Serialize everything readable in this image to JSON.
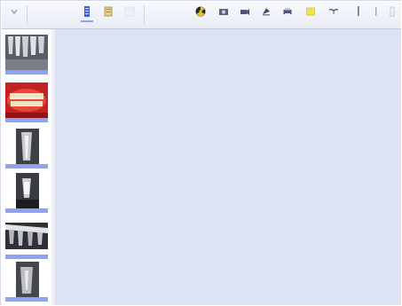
{
  "toolbar": {
    "left_buttons": [
      {
        "icon": "chevron-down-icon"
      },
      {
        "icon": "patient-list-icon"
      },
      {
        "icon": "folder-icon"
      },
      {
        "icon": "blank-icon"
      }
    ],
    "right_buttons": [
      {
        "icon": "radiation-icon"
      },
      {
        "icon": "camera-icon"
      },
      {
        "icon": "video-camera-icon"
      },
      {
        "icon": "scanner-icon"
      },
      {
        "icon": "print-icon"
      },
      {
        "icon": "note-icon"
      },
      {
        "icon": "tooth-chart-icon"
      },
      {
        "icon": "ruler-icon"
      },
      {
        "icon": "zoom-icon"
      },
      {
        "icon": "settings-icon"
      }
    ]
  },
  "sidebar": {
    "thumbnails": [
      {
        "type": "xray-bitewing"
      },
      {
        "type": "intraoral-photo"
      },
      {
        "type": "xray-periapical"
      },
      {
        "type": "xray-periapical-implant"
      },
      {
        "type": "xray-bitewing"
      },
      {
        "type": "xray-periapical"
      }
    ]
  },
  "colors": {
    "canvas": "#dde3f3",
    "caption_bar": "#8da2f0"
  }
}
